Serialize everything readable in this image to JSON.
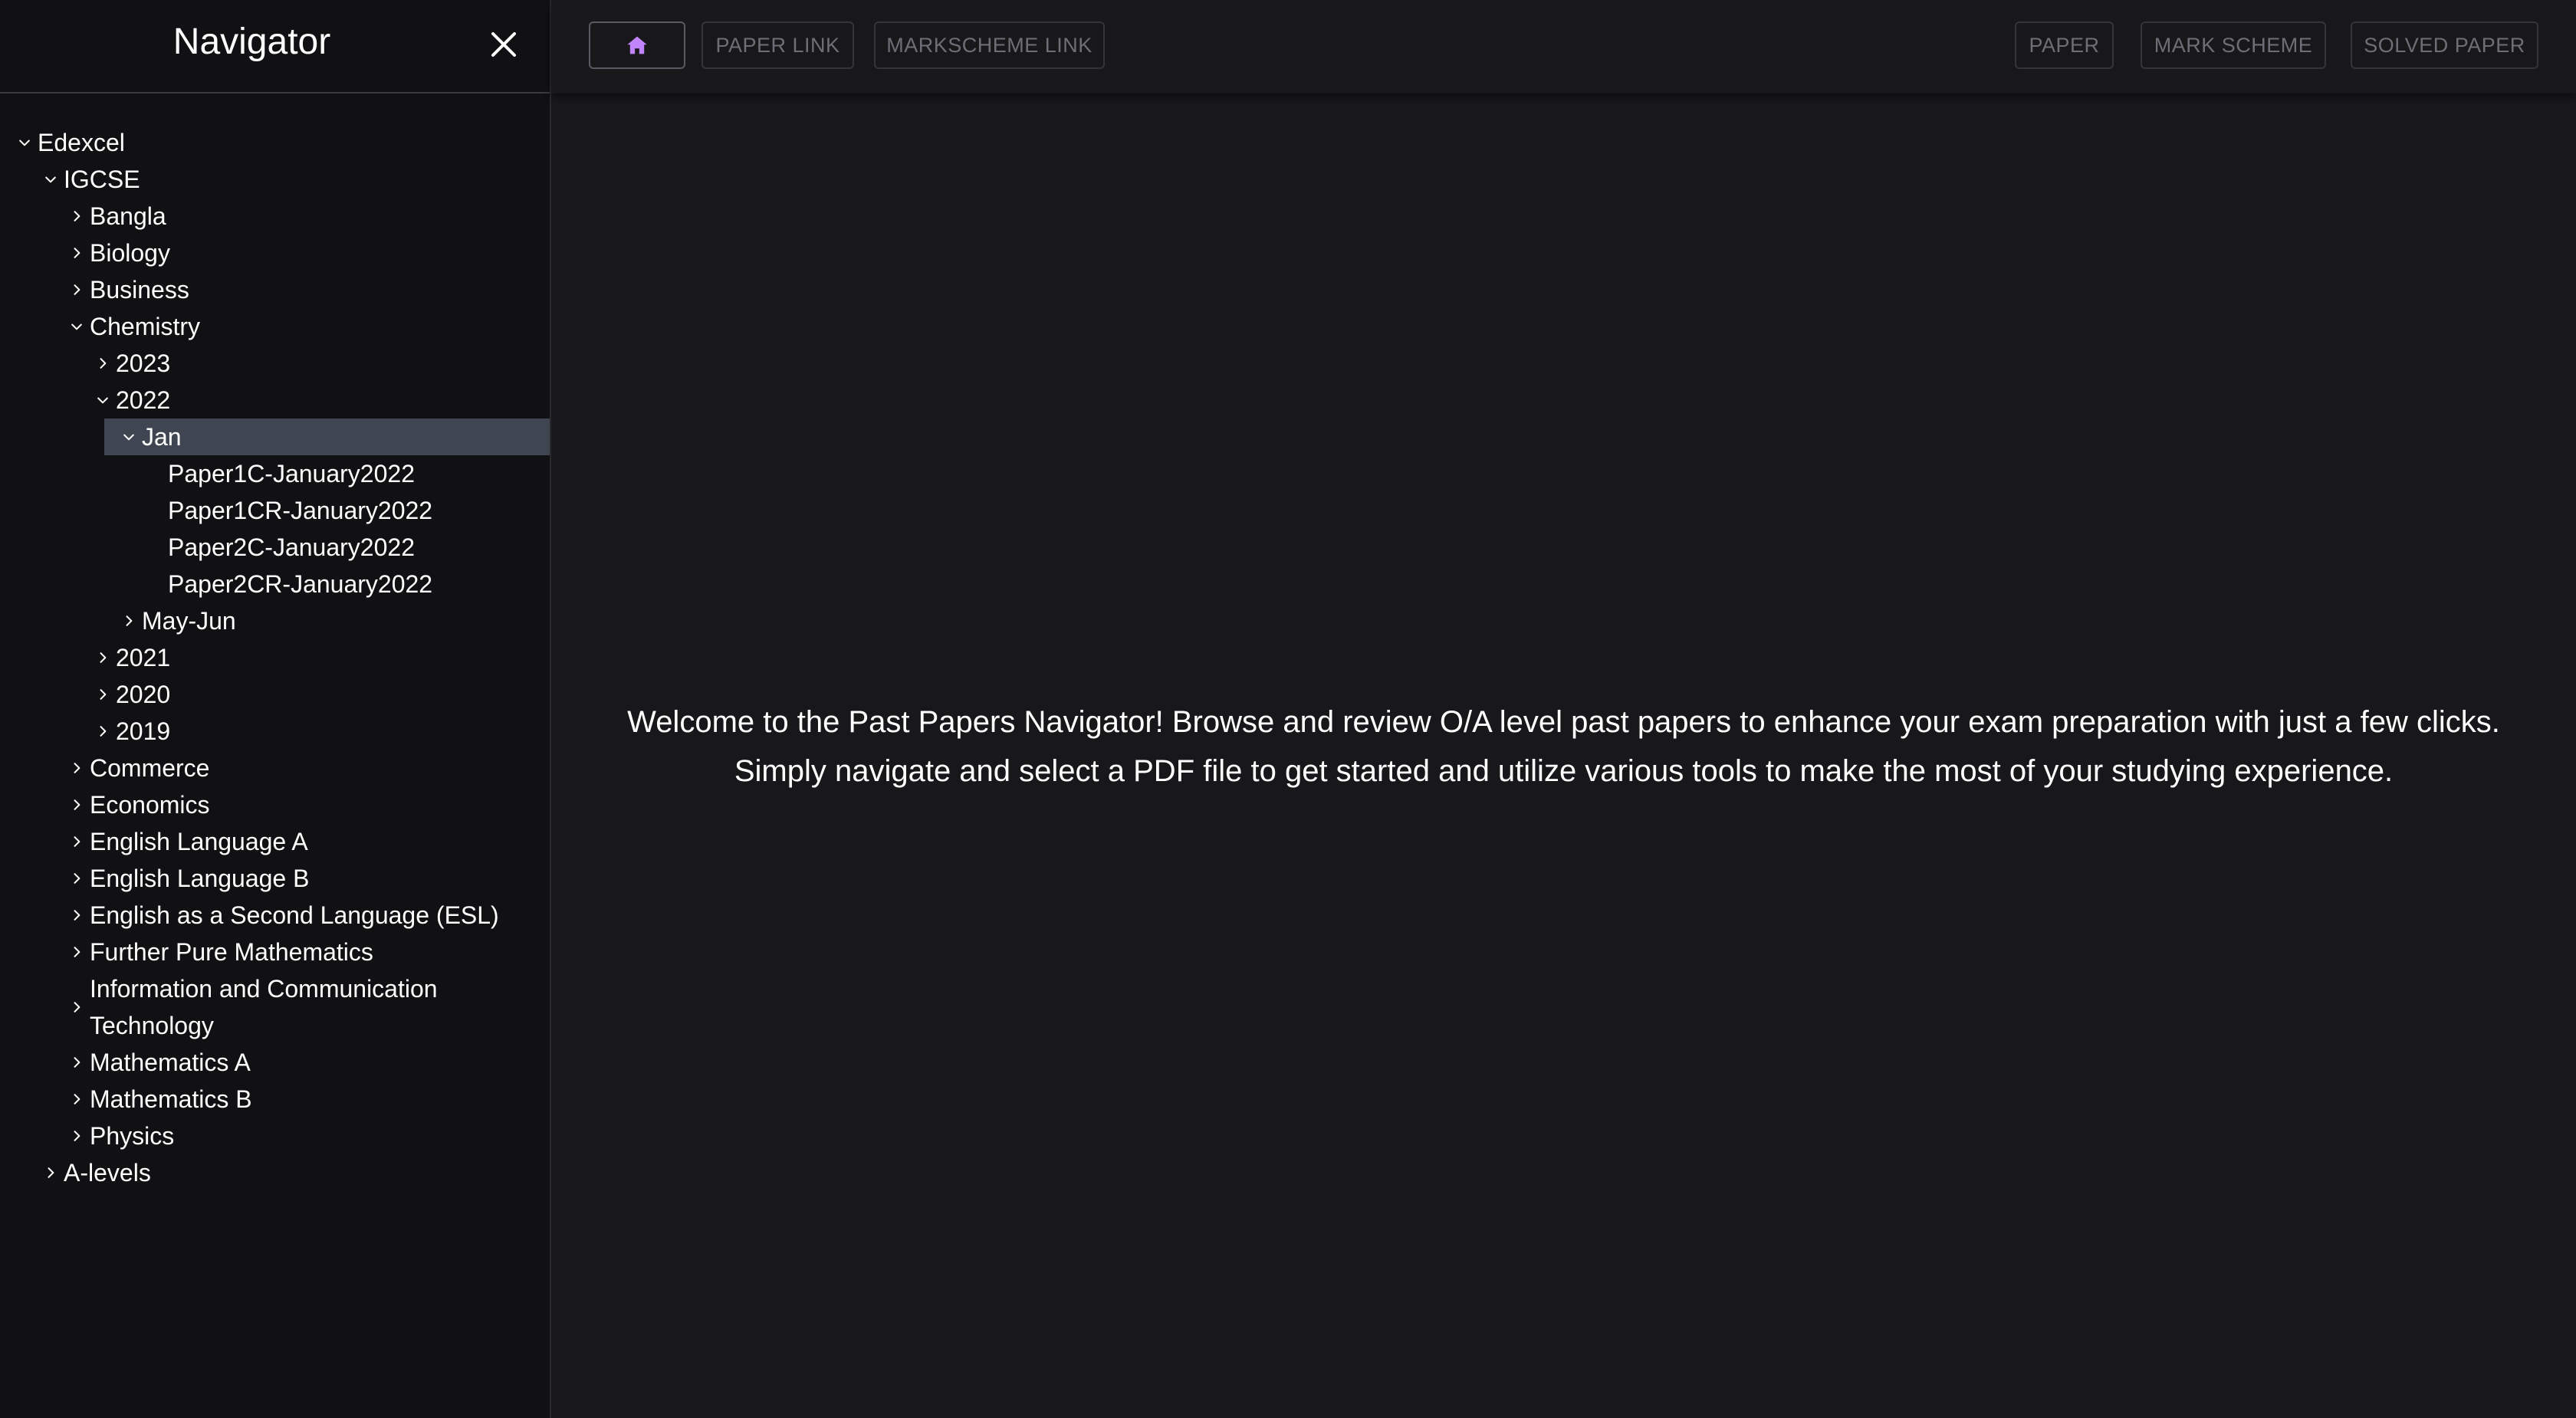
{
  "sidebar": {
    "title": "Navigator",
    "tree": [
      {
        "label": "Edexcel",
        "depth": 0,
        "state": "expanded"
      },
      {
        "label": "IGCSE",
        "depth": 1,
        "state": "expanded"
      },
      {
        "label": "Bangla",
        "depth": 2,
        "state": "collapsed"
      },
      {
        "label": "Biology",
        "depth": 2,
        "state": "collapsed"
      },
      {
        "label": "Business",
        "depth": 2,
        "state": "collapsed"
      },
      {
        "label": "Chemistry",
        "depth": 2,
        "state": "expanded"
      },
      {
        "label": "2023",
        "depth": 3,
        "state": "collapsed"
      },
      {
        "label": "2022",
        "depth": 3,
        "state": "expanded"
      },
      {
        "label": "Jan",
        "depth": 4,
        "state": "expanded",
        "selected": true
      },
      {
        "label": "Paper1C-January2022",
        "depth": 5,
        "state": "leaf"
      },
      {
        "label": "Paper1CR-January2022",
        "depth": 5,
        "state": "leaf"
      },
      {
        "label": "Paper2C-January2022",
        "depth": 5,
        "state": "leaf"
      },
      {
        "label": "Paper2CR-January2022",
        "depth": 5,
        "state": "leaf"
      },
      {
        "label": "May-Jun",
        "depth": 4,
        "state": "collapsed"
      },
      {
        "label": "2021",
        "depth": 3,
        "state": "collapsed"
      },
      {
        "label": "2020",
        "depth": 3,
        "state": "collapsed"
      },
      {
        "label": "2019",
        "depth": 3,
        "state": "collapsed"
      },
      {
        "label": "Commerce",
        "depth": 2,
        "state": "collapsed"
      },
      {
        "label": "Economics",
        "depth": 2,
        "state": "collapsed"
      },
      {
        "label": "English Language A",
        "depth": 2,
        "state": "collapsed"
      },
      {
        "label": "English Language B",
        "depth": 2,
        "state": "collapsed"
      },
      {
        "label": "English as a Second Language (ESL)",
        "depth": 2,
        "state": "collapsed"
      },
      {
        "label": "Further Pure Mathematics",
        "depth": 2,
        "state": "collapsed"
      },
      {
        "label": "Information and Communication Technology",
        "depth": 2,
        "state": "collapsed",
        "wrap": true
      },
      {
        "label": "Mathematics A",
        "depth": 2,
        "state": "collapsed"
      },
      {
        "label": "Mathematics B",
        "depth": 2,
        "state": "collapsed"
      },
      {
        "label": "Physics",
        "depth": 2,
        "state": "collapsed"
      },
      {
        "label": "A-levels",
        "depth": 1,
        "state": "collapsed"
      }
    ]
  },
  "toolbar": {
    "home_icon": "home-icon",
    "paper_link_label": "PAPER LINK",
    "markscheme_link_label": "MARKSCHEME LINK",
    "paper_label": "PAPER",
    "mark_scheme_label": "MARK SCHEME",
    "solved_paper_label": "SOLVED PAPER"
  },
  "main": {
    "welcome_line1": "Welcome to the Past Papers Navigator! Browse and review O/A level past papers to enhance your exam preparation with just a few clicks.",
    "welcome_line2": "Simply navigate and select a PDF file to get started and utilize various tools to make the most of your studying experience."
  },
  "colors": {
    "background": "#18181b",
    "sidebar_bg": "#111113",
    "selected_row": "#3f4651",
    "home_icon": "#c084fc",
    "muted_button_text": "#6e6e76"
  }
}
